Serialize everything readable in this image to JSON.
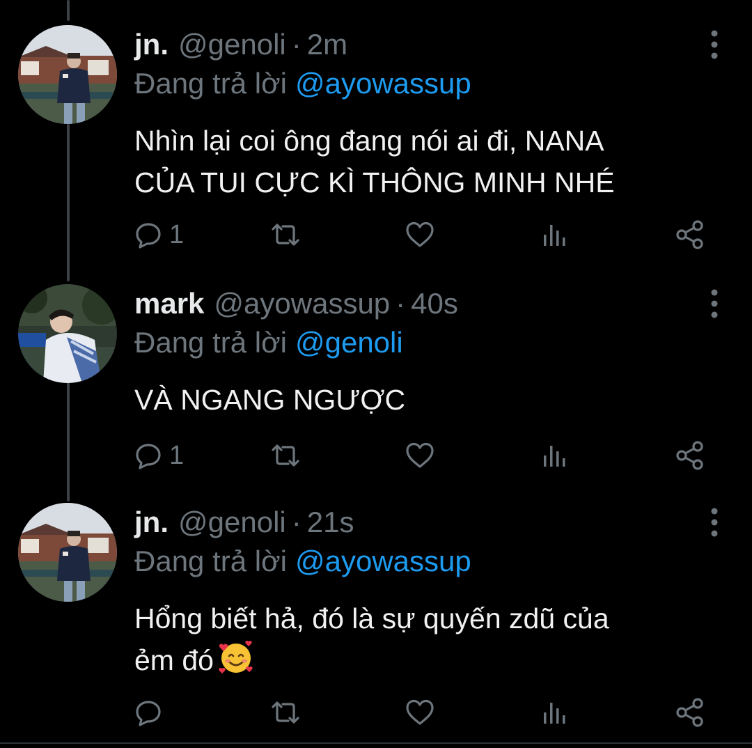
{
  "colors": {
    "background": "#000000",
    "text": "#e7e9ea",
    "secondary": "#6e767d",
    "link": "#1d9bf0",
    "thread_line": "#3d4146"
  },
  "reply_prefix": "Đang trả lời",
  "tweets": [
    {
      "name": "jn.",
      "handle": "@genoli",
      "separator": "·",
      "time": "2m",
      "reply_to": "@ayowassup",
      "text_lines": [
        "Nhìn lại coi ông đang nói ai đi, NANA",
        "CỦA TUI CỰC KÌ THÔNG MINH NHÉ"
      ],
      "reply_count": "1",
      "avatar": "avatar-jn"
    },
    {
      "name": "mark",
      "handle": "@ayowassup",
      "separator": "·",
      "time": "40s",
      "reply_to": "@genoli",
      "text_lines": [
        "VÀ NGANG NGƯỢC"
      ],
      "reply_count": "1",
      "avatar": "avatar-mark"
    },
    {
      "name": "jn.",
      "handle": "@genoli",
      "separator": "·",
      "time": "21s",
      "reply_to": "@ayowassup",
      "text_lines": [
        "Hổng biết hả, đó là sự quyến zdũ của",
        "ẻm đó"
      ],
      "emoji": "smiling-face-with-hearts",
      "reply_count": "",
      "avatar": "avatar-jn"
    }
  ],
  "icons": {
    "reply": "reply-icon",
    "retweet": "retweet-icon",
    "like": "like-icon",
    "analytics": "analytics-icon",
    "share": "share-icon",
    "more": "more-options-icon"
  }
}
